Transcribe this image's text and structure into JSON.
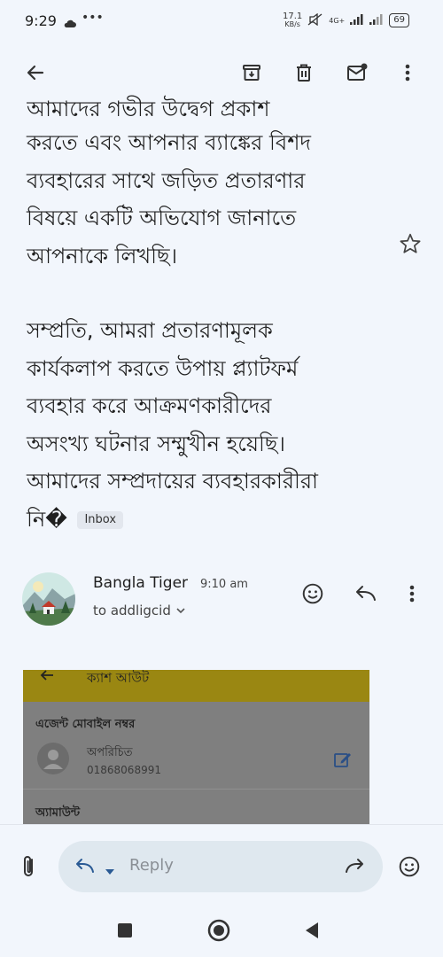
{
  "status_bar": {
    "time": "9:29",
    "speed_value": "17.1",
    "speed_unit": "KB/s",
    "network": "4G+",
    "battery": "69"
  },
  "app_bar": {
    "icons": [
      "back-arrow-icon",
      "archive-icon",
      "delete-icon",
      "mark-unread-icon",
      "more-vert-icon"
    ]
  },
  "email": {
    "body_lines_para1": [
      "আমাদের গভীর উদ্বেগ প্রকাশ",
      "করতে এবং আপনার ব্যাঙ্কের বিশদ",
      "ব্যবহারের সাথে জড়িত প্রতারণার",
      "বিষয়ে একটি অভিযোগ জানাতে",
      "আপনাকে লিখছি।"
    ],
    "body_lines_para2": [
      "সম্প্রতি, আমরা প্রতারণামূলক",
      "কার্যকলাপ করতে উপায় প্ল্যাটফর্ম",
      "ব্যবহার করে আক্রমণকারীদের",
      "অসংখ্য ঘটনার সম্মুখীন হয়েছি।",
      "আমাদের সম্প্রদায়ের ব্যবহারকারীরা",
      "নি�"
    ],
    "label_chip": "Inbox"
  },
  "sender": {
    "name": "Bangla Tiger",
    "time": "9:10 am",
    "to": "to addligcid"
  },
  "attachment": {
    "title": "ক্যাশ আউট",
    "agent_label": "এজেন্ট মোবাইল নম্বর",
    "contact_name": "অপরিচিত",
    "contact_phone": "01868068991",
    "amount_label": "অ্যামাউন্ট"
  },
  "reply_bar": {
    "placeholder": "Reply"
  },
  "colors": {
    "background": "#f2f6fc",
    "attachment_header": "#9a8712",
    "attachment_body": "#7f7f7f",
    "edit_icon": "#2a4f86"
  }
}
